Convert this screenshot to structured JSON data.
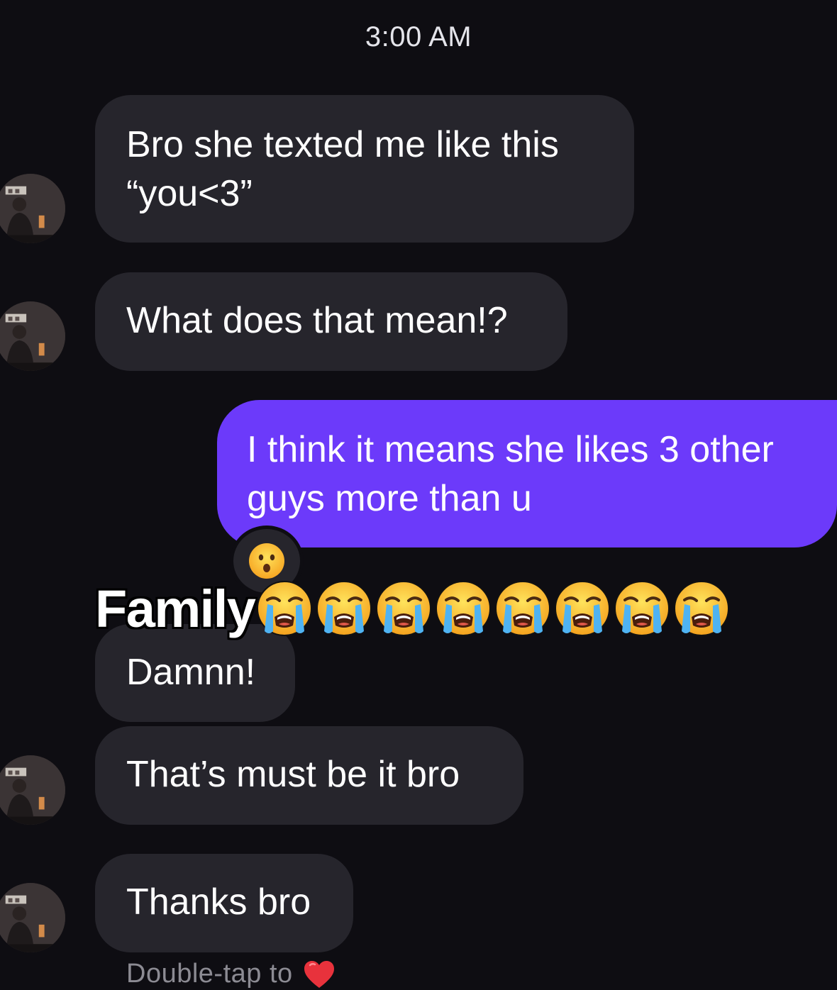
{
  "status": {
    "time": "3:00 AM"
  },
  "messages": [
    {
      "sender": "them",
      "text": "Bro she texted me like this “you<3”"
    },
    {
      "sender": "them",
      "text": "What does that mean!?"
    },
    {
      "sender": "me",
      "text": "I think it means she likes 3 other guys more than u",
      "reaction": "hushed-face-emoji"
    },
    {
      "sender": "them",
      "text": "Damnn!"
    },
    {
      "sender": "them",
      "text": "That’s must be it bro"
    },
    {
      "sender": "them",
      "text": "Thanks bro"
    }
  ],
  "overlay": {
    "caption": "Family",
    "emoji": "loudly-crying-face-emoji",
    "emoji_count": 8
  },
  "footer": {
    "hint": "Double-tap to",
    "icon": "heart-icon"
  },
  "colors": {
    "background": "#0e0d12",
    "incoming_bubble": "#26252c",
    "outgoing_bubble": "#6c3afa",
    "hint_text": "#8c8b93",
    "heart": "#e8323c"
  }
}
